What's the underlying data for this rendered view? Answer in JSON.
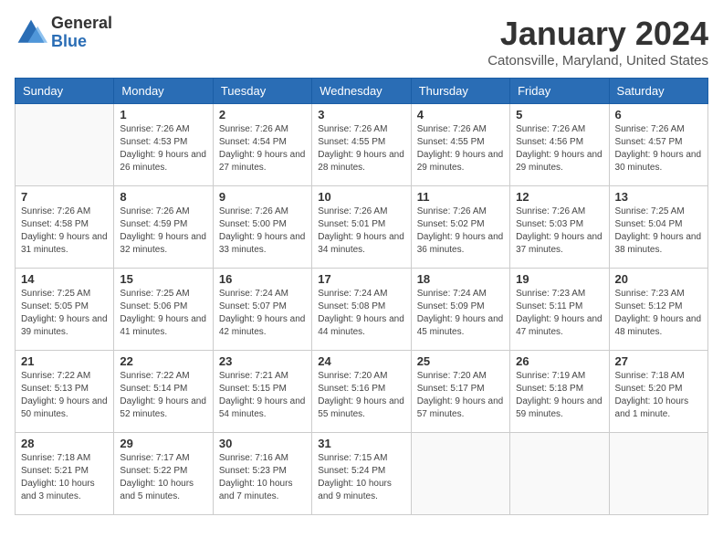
{
  "logo": {
    "general": "General",
    "blue": "Blue"
  },
  "header": {
    "month_year": "January 2024",
    "location": "Catonsville, Maryland, United States"
  },
  "days_of_week": [
    "Sunday",
    "Monday",
    "Tuesday",
    "Wednesday",
    "Thursday",
    "Friday",
    "Saturday"
  ],
  "weeks": [
    [
      {
        "day": "",
        "sunrise": "",
        "sunset": "",
        "daylight": ""
      },
      {
        "day": "1",
        "sunrise": "Sunrise: 7:26 AM",
        "sunset": "Sunset: 4:53 PM",
        "daylight": "Daylight: 9 hours and 26 minutes."
      },
      {
        "day": "2",
        "sunrise": "Sunrise: 7:26 AM",
        "sunset": "Sunset: 4:54 PM",
        "daylight": "Daylight: 9 hours and 27 minutes."
      },
      {
        "day": "3",
        "sunrise": "Sunrise: 7:26 AM",
        "sunset": "Sunset: 4:55 PM",
        "daylight": "Daylight: 9 hours and 28 minutes."
      },
      {
        "day": "4",
        "sunrise": "Sunrise: 7:26 AM",
        "sunset": "Sunset: 4:55 PM",
        "daylight": "Daylight: 9 hours and 29 minutes."
      },
      {
        "day": "5",
        "sunrise": "Sunrise: 7:26 AM",
        "sunset": "Sunset: 4:56 PM",
        "daylight": "Daylight: 9 hours and 29 minutes."
      },
      {
        "day": "6",
        "sunrise": "Sunrise: 7:26 AM",
        "sunset": "Sunset: 4:57 PM",
        "daylight": "Daylight: 9 hours and 30 minutes."
      }
    ],
    [
      {
        "day": "7",
        "sunrise": "Sunrise: 7:26 AM",
        "sunset": "Sunset: 4:58 PM",
        "daylight": "Daylight: 9 hours and 31 minutes."
      },
      {
        "day": "8",
        "sunrise": "Sunrise: 7:26 AM",
        "sunset": "Sunset: 4:59 PM",
        "daylight": "Daylight: 9 hours and 32 minutes."
      },
      {
        "day": "9",
        "sunrise": "Sunrise: 7:26 AM",
        "sunset": "Sunset: 5:00 PM",
        "daylight": "Daylight: 9 hours and 33 minutes."
      },
      {
        "day": "10",
        "sunrise": "Sunrise: 7:26 AM",
        "sunset": "Sunset: 5:01 PM",
        "daylight": "Daylight: 9 hours and 34 minutes."
      },
      {
        "day": "11",
        "sunrise": "Sunrise: 7:26 AM",
        "sunset": "Sunset: 5:02 PM",
        "daylight": "Daylight: 9 hours and 36 minutes."
      },
      {
        "day": "12",
        "sunrise": "Sunrise: 7:26 AM",
        "sunset": "Sunset: 5:03 PM",
        "daylight": "Daylight: 9 hours and 37 minutes."
      },
      {
        "day": "13",
        "sunrise": "Sunrise: 7:25 AM",
        "sunset": "Sunset: 5:04 PM",
        "daylight": "Daylight: 9 hours and 38 minutes."
      }
    ],
    [
      {
        "day": "14",
        "sunrise": "Sunrise: 7:25 AM",
        "sunset": "Sunset: 5:05 PM",
        "daylight": "Daylight: 9 hours and 39 minutes."
      },
      {
        "day": "15",
        "sunrise": "Sunrise: 7:25 AM",
        "sunset": "Sunset: 5:06 PM",
        "daylight": "Daylight: 9 hours and 41 minutes."
      },
      {
        "day": "16",
        "sunrise": "Sunrise: 7:24 AM",
        "sunset": "Sunset: 5:07 PM",
        "daylight": "Daylight: 9 hours and 42 minutes."
      },
      {
        "day": "17",
        "sunrise": "Sunrise: 7:24 AM",
        "sunset": "Sunset: 5:08 PM",
        "daylight": "Daylight: 9 hours and 44 minutes."
      },
      {
        "day": "18",
        "sunrise": "Sunrise: 7:24 AM",
        "sunset": "Sunset: 5:09 PM",
        "daylight": "Daylight: 9 hours and 45 minutes."
      },
      {
        "day": "19",
        "sunrise": "Sunrise: 7:23 AM",
        "sunset": "Sunset: 5:11 PM",
        "daylight": "Daylight: 9 hours and 47 minutes."
      },
      {
        "day": "20",
        "sunrise": "Sunrise: 7:23 AM",
        "sunset": "Sunset: 5:12 PM",
        "daylight": "Daylight: 9 hours and 48 minutes."
      }
    ],
    [
      {
        "day": "21",
        "sunrise": "Sunrise: 7:22 AM",
        "sunset": "Sunset: 5:13 PM",
        "daylight": "Daylight: 9 hours and 50 minutes."
      },
      {
        "day": "22",
        "sunrise": "Sunrise: 7:22 AM",
        "sunset": "Sunset: 5:14 PM",
        "daylight": "Daylight: 9 hours and 52 minutes."
      },
      {
        "day": "23",
        "sunrise": "Sunrise: 7:21 AM",
        "sunset": "Sunset: 5:15 PM",
        "daylight": "Daylight: 9 hours and 54 minutes."
      },
      {
        "day": "24",
        "sunrise": "Sunrise: 7:20 AM",
        "sunset": "Sunset: 5:16 PM",
        "daylight": "Daylight: 9 hours and 55 minutes."
      },
      {
        "day": "25",
        "sunrise": "Sunrise: 7:20 AM",
        "sunset": "Sunset: 5:17 PM",
        "daylight": "Daylight: 9 hours and 57 minutes."
      },
      {
        "day": "26",
        "sunrise": "Sunrise: 7:19 AM",
        "sunset": "Sunset: 5:18 PM",
        "daylight": "Daylight: 9 hours and 59 minutes."
      },
      {
        "day": "27",
        "sunrise": "Sunrise: 7:18 AM",
        "sunset": "Sunset: 5:20 PM",
        "daylight": "Daylight: 10 hours and 1 minute."
      }
    ],
    [
      {
        "day": "28",
        "sunrise": "Sunrise: 7:18 AM",
        "sunset": "Sunset: 5:21 PM",
        "daylight": "Daylight: 10 hours and 3 minutes."
      },
      {
        "day": "29",
        "sunrise": "Sunrise: 7:17 AM",
        "sunset": "Sunset: 5:22 PM",
        "daylight": "Daylight: 10 hours and 5 minutes."
      },
      {
        "day": "30",
        "sunrise": "Sunrise: 7:16 AM",
        "sunset": "Sunset: 5:23 PM",
        "daylight": "Daylight: 10 hours and 7 minutes."
      },
      {
        "day": "31",
        "sunrise": "Sunrise: 7:15 AM",
        "sunset": "Sunset: 5:24 PM",
        "daylight": "Daylight: 10 hours and 9 minutes."
      },
      {
        "day": "",
        "sunrise": "",
        "sunset": "",
        "daylight": ""
      },
      {
        "day": "",
        "sunrise": "",
        "sunset": "",
        "daylight": ""
      },
      {
        "day": "",
        "sunrise": "",
        "sunset": "",
        "daylight": ""
      }
    ]
  ]
}
